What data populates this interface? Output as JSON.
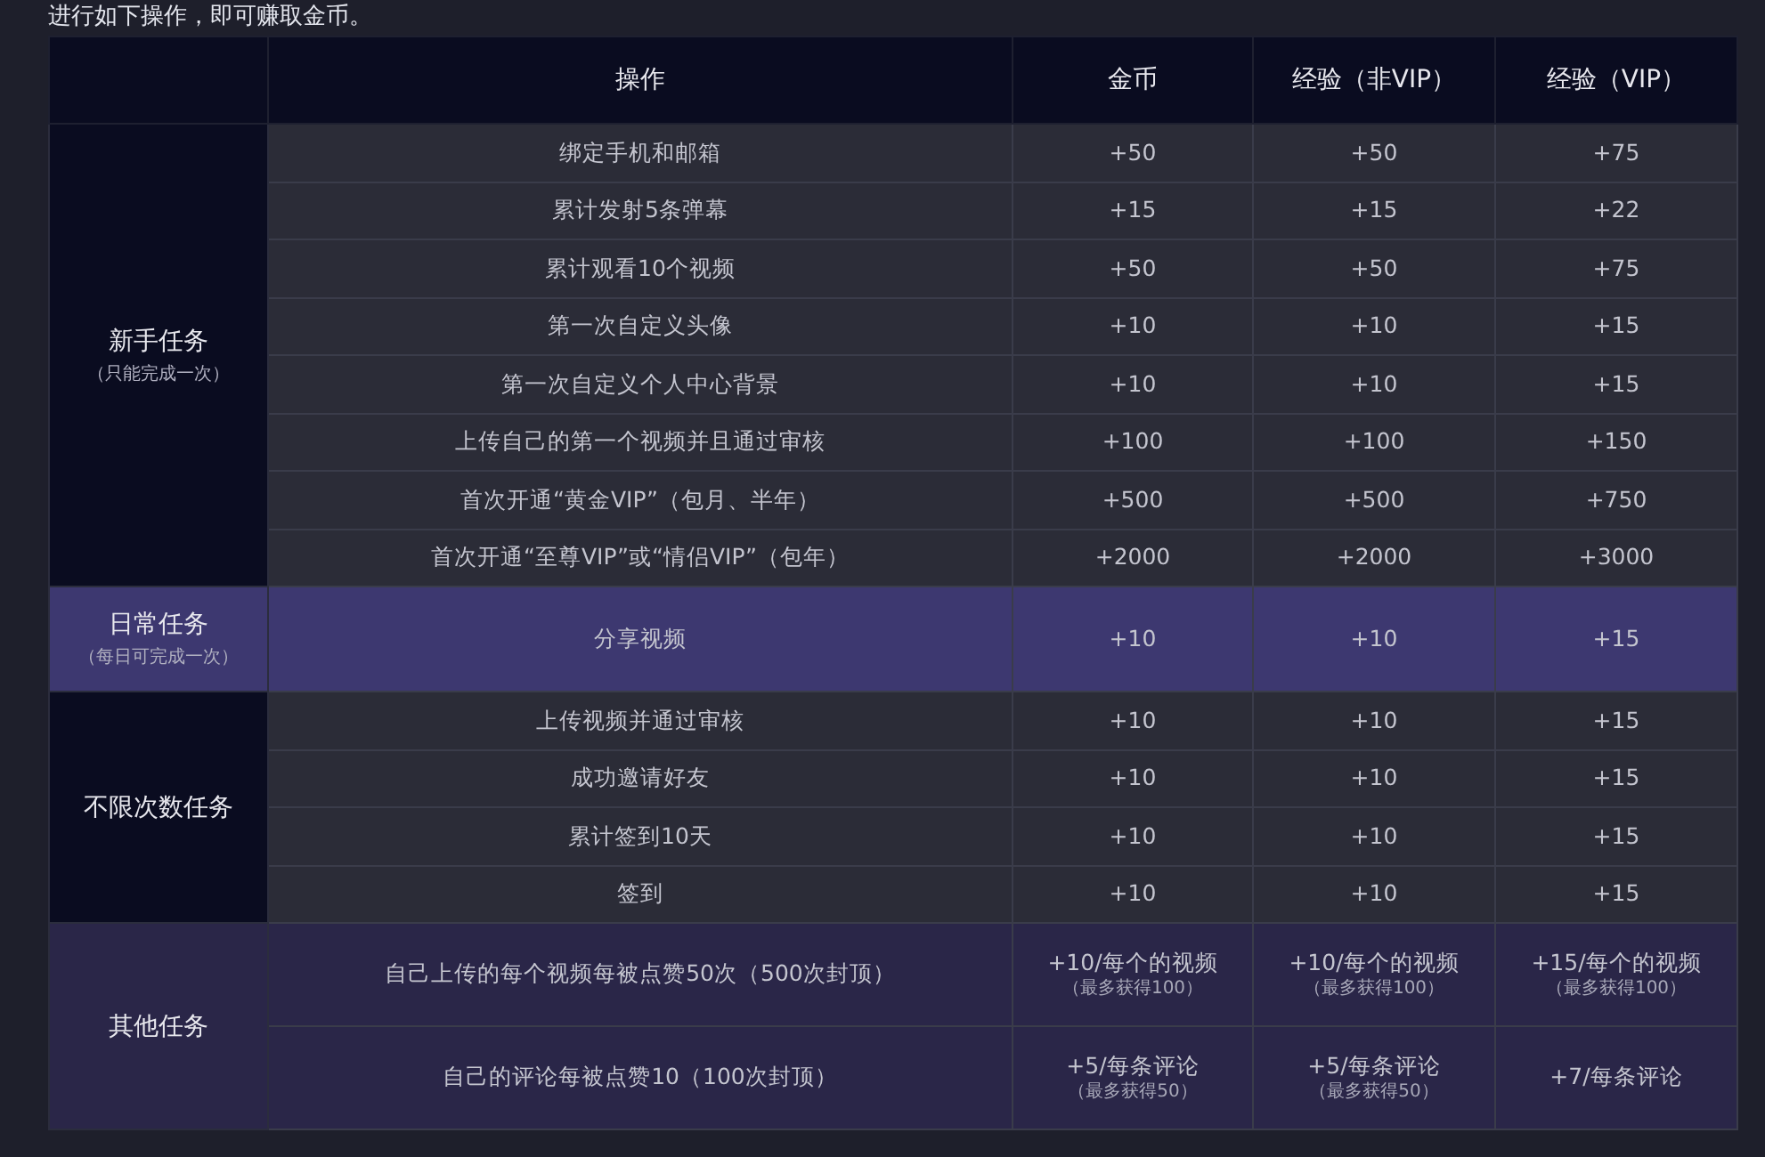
{
  "intro": "进行如下操作，即可赚取金币。",
  "columns": [
    "操作",
    "金币",
    "经验（非VIP）",
    "经验（VIP）"
  ],
  "groups": [
    {
      "name": "新手任务",
      "note": "（只能完成一次）",
      "kind": "basic",
      "rows": [
        {
          "task": "绑定手机和邮箱",
          "values": [
            {
              "text": "+50"
            },
            {
              "text": "+50"
            },
            {
              "text": "+75"
            }
          ]
        },
        {
          "task": "累计发射5条弹幕",
          "values": [
            {
              "text": "+15"
            },
            {
              "text": "+15"
            },
            {
              "text": "+22"
            }
          ]
        },
        {
          "task": "累计观看10个视频",
          "values": [
            {
              "text": "+50"
            },
            {
              "text": "+50"
            },
            {
              "text": "+75"
            }
          ]
        },
        {
          "task": "第一次自定义头像",
          "values": [
            {
              "text": "+10"
            },
            {
              "text": "+10"
            },
            {
              "text": "+15"
            }
          ]
        },
        {
          "task": "第一次自定义个人中心背景",
          "values": [
            {
              "text": "+10"
            },
            {
              "text": "+10"
            },
            {
              "text": "+15"
            }
          ]
        },
        {
          "task": "上传自己的第一个视频并且通过审核",
          "values": [
            {
              "text": "+100"
            },
            {
              "text": "+100"
            },
            {
              "text": "+150"
            }
          ]
        },
        {
          "task": "首次开通“黄金VIP”（包月、半年）",
          "values": [
            {
              "text": "+500"
            },
            {
              "text": "+500"
            },
            {
              "text": "+750"
            }
          ]
        },
        {
          "task": "首次开通“至尊VIP”或“情侣VIP”（包年）",
          "values": [
            {
              "text": "+2000"
            },
            {
              "text": "+2000"
            },
            {
              "text": "+3000"
            }
          ]
        }
      ]
    },
    {
      "name": "日常任务",
      "note": "（每日可完成一次）",
      "kind": "daily",
      "rows": [
        {
          "task": "分享视频",
          "values": [
            {
              "text": "+10"
            },
            {
              "text": "+10"
            },
            {
              "text": "+15"
            }
          ]
        }
      ]
    },
    {
      "name": "不限次数任务",
      "kind": "basic",
      "rows": [
        {
          "task": "上传视频并通过审核",
          "values": [
            {
              "text": "+10"
            },
            {
              "text": "+10"
            },
            {
              "text": "+15"
            }
          ]
        },
        {
          "task": "成功邀请好友",
          "values": [
            {
              "text": "+10"
            },
            {
              "text": "+10"
            },
            {
              "text": "+15"
            }
          ]
        },
        {
          "task": "累计签到10天",
          "values": [
            {
              "text": "+10"
            },
            {
              "text": "+10"
            },
            {
              "text": "+15"
            }
          ]
        },
        {
          "task": "签到",
          "values": [
            {
              "text": "+10"
            },
            {
              "text": "+10"
            },
            {
              "text": "+15"
            }
          ]
        }
      ]
    },
    {
      "name": "其他任务",
      "kind": "other",
      "rows": [
        {
          "task": "自己上传的每个视频每被点赞50次（500次封顶）",
          "values": [
            {
              "text": "+10/每个的视频",
              "note": "（最多获得100）"
            },
            {
              "text": "+10/每个的视频",
              "note": "（最多获得100）"
            },
            {
              "text": "+15/每个的视频",
              "note": "（最多获得100）"
            }
          ]
        },
        {
          "task": "自己的评论每被点赞10（100次封顶）",
          "values": [
            {
              "text": "+5/每条评论",
              "note": "（最多获得50）"
            },
            {
              "text": "+5/每条评论",
              "note": "（最多获得50）"
            },
            {
              "text": "+7/每条评论"
            }
          ]
        }
      ]
    }
  ]
}
